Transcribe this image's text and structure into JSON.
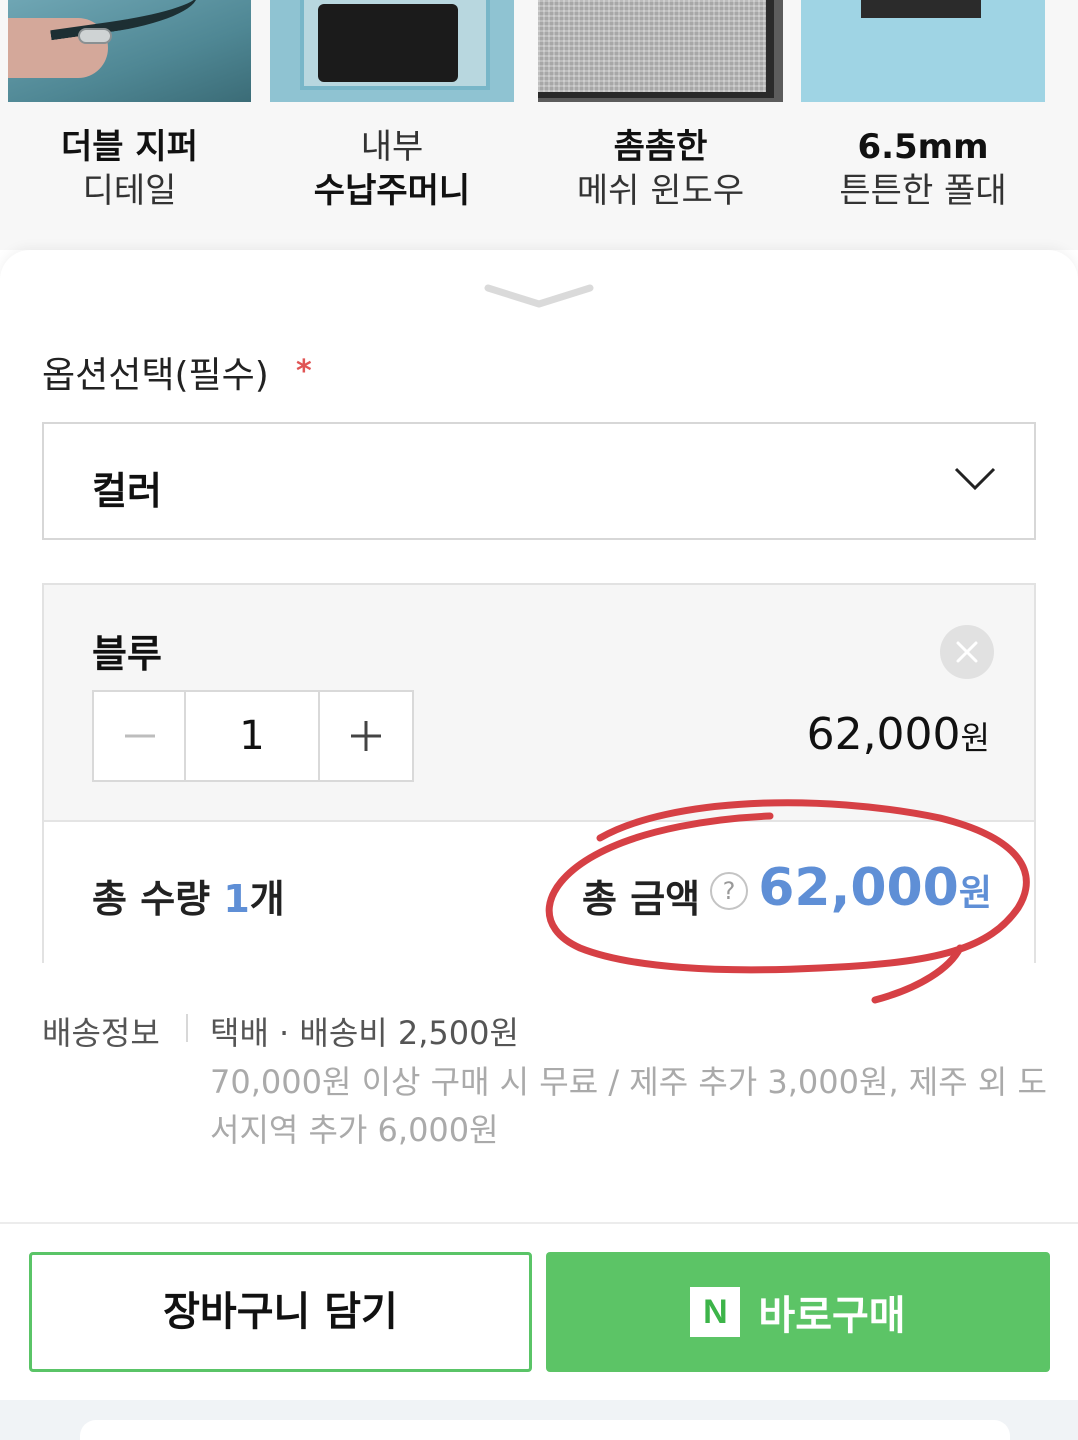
{
  "features": [
    {
      "line1": "더블 지퍼",
      "line1_bold": true,
      "line2": "디테일",
      "line2_bold": false
    },
    {
      "line1": "내부",
      "line1_bold": false,
      "line2": "수납주머니",
      "line2_bold": true
    },
    {
      "line1": "촘촘한",
      "line1_bold": true,
      "line2": "메쉬 윈도우",
      "line2_bold": false
    },
    {
      "line1": "6.5mm",
      "line1_bold": true,
      "line2": "튼튼한 폴대",
      "line2_bold": false
    }
  ],
  "option": {
    "label": "옵션선택(필수)",
    "required_mark": "*",
    "select_value": "컬러"
  },
  "item": {
    "name": "블루",
    "quantity": "1",
    "price": "62,000",
    "price_unit": "원"
  },
  "total": {
    "qty_prefix": "총 수량 ",
    "qty_value": "1",
    "qty_suffix": "개",
    "price_label": "총 금액",
    "help": "?",
    "price": "62,000",
    "price_unit": "원"
  },
  "shipping": {
    "label": "배송정보",
    "main": "택배 · 배송비 2,500원",
    "detail": "70,000원 이상 구매 시 무료 / 제주 추가 3,000원, 제주 외 도서지역 추가 6,000원"
  },
  "buttons": {
    "cart": "장바구니 담기",
    "buy_logo": "N",
    "buy": "바로구매"
  },
  "colors": {
    "accent_blue": "#5f8fd6",
    "naver_green": "#5cc466",
    "annotation_red": "#d64045"
  }
}
